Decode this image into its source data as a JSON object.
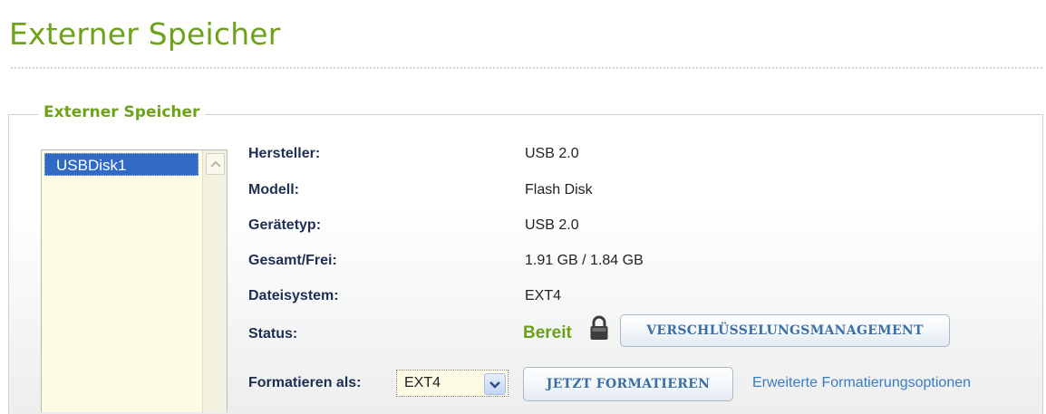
{
  "header": {
    "title": "Externer Speicher"
  },
  "panel": {
    "legend": "Externer Speicher"
  },
  "disk_list": {
    "items": [
      "USBDisk1"
    ],
    "selected_index": 0
  },
  "details": [
    {
      "label": "Hersteller:",
      "value": "USB 2.0"
    },
    {
      "label": "Modell:",
      "value": "Flash Disk"
    },
    {
      "label": "Gerätetyp:",
      "value": "USB 2.0"
    },
    {
      "label": "Gesamt/Frei:",
      "value": "1.91 GB / 1.84 GB"
    },
    {
      "label": "Dateisystem:",
      "value": "EXT4"
    }
  ],
  "status": {
    "label": "Status:",
    "value": "Bereit",
    "value_color": "#6a9f1a",
    "lock_icon": "padlock-icon",
    "encryption_button_label": "VERSCHLÜSSELUNGSMANAGEMENT"
  },
  "format": {
    "label": "Formatieren als:",
    "selected": "EXT4",
    "button_label": "JETZT FORMATIEREN",
    "advanced_link": "Erweiterte Formatierungsoptionen"
  },
  "colors": {
    "accent_green": "#6ea21a",
    "label_navy": "#1e2e53",
    "selection_blue": "#316ac5",
    "link_blue": "#3a7cc4",
    "list_background": "#fdfbe4"
  }
}
